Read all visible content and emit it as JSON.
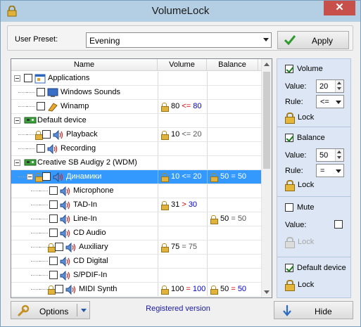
{
  "window": {
    "title": "VolumeLock",
    "close_glyph": "✕"
  },
  "preset": {
    "label": "User Preset:",
    "value": "Evening",
    "apply_label": "Apply"
  },
  "columns": {
    "name": "Name",
    "volume": "Volume",
    "balance": "Balance"
  },
  "rows": [
    {
      "name": "Applications",
      "level": 0,
      "icon": "applications-icon",
      "expand": true,
      "checkbox": true,
      "locked": false
    },
    {
      "name": "Windows Sounds",
      "level": 1,
      "icon": "windows-sounds-icon",
      "checkbox": true,
      "locked": false
    },
    {
      "name": "Winamp",
      "level": 1,
      "icon": "winamp-icon",
      "checkbox": true,
      "locked": false,
      "vol": {
        "locked": true,
        "value": "80",
        "rule": "<=",
        "target": "80",
        "rule_color": "red",
        "target_color": "blue"
      }
    },
    {
      "name": "Default device",
      "level": 0,
      "icon": "sound-card-icon",
      "expand": true,
      "locked": false
    },
    {
      "name": "Playback",
      "level": 1,
      "icon": "speaker-icon",
      "checkbox": true,
      "locked": true,
      "vol": {
        "locked": true,
        "value": "10",
        "rule": "<=",
        "target": "20",
        "rule_color": "gray",
        "target_color": "gray"
      }
    },
    {
      "name": "Recording",
      "level": 1,
      "icon": "speaker-icon",
      "checkbox": true,
      "locked": false
    },
    {
      "name": "Creative SB Audigy 2 (WDM)",
      "level": 0,
      "icon": "sound-card-icon",
      "expand": true,
      "locked": false
    },
    {
      "name": "Динамики",
      "level": 1,
      "icon": "speaker-icon",
      "expand": true,
      "locked": true,
      "selected": true,
      "vol": {
        "locked": true,
        "value": "10",
        "rule": "<=",
        "target": "20",
        "rule_color": "none",
        "target_color": "none"
      },
      "bal": {
        "locked": true,
        "value": "50",
        "rule": "=",
        "target": "50",
        "rule_color": "none",
        "target_color": "none"
      }
    },
    {
      "name": "Microphone",
      "level": 2,
      "icon": "speaker-icon",
      "checkbox": true,
      "locked": false
    },
    {
      "name": "TAD-In",
      "level": 2,
      "icon": "speaker-icon",
      "checkbox": true,
      "locked": false,
      "vol": {
        "locked": true,
        "value": "31",
        "rule": ">",
        "target": "30",
        "rule_color": "red",
        "target_color": "blue"
      }
    },
    {
      "name": "Line-In",
      "level": 2,
      "icon": "speaker-icon",
      "checkbox": true,
      "locked": false,
      "bal": {
        "locked": true,
        "value": "50",
        "rule": "=",
        "target": "50",
        "rule_color": "gray",
        "target_color": "gray"
      }
    },
    {
      "name": "CD Audio",
      "level": 2,
      "icon": "speaker-icon",
      "checkbox": true,
      "locked": false
    },
    {
      "name": "Auxiliary",
      "level": 2,
      "icon": "speaker-icon",
      "checkbox": true,
      "locked": true,
      "vol": {
        "locked": true,
        "value": "75",
        "rule": "=",
        "target": "75",
        "rule_color": "gray",
        "target_color": "gray"
      }
    },
    {
      "name": "CD Digital",
      "level": 2,
      "icon": "speaker-icon",
      "checkbox": true,
      "locked": false
    },
    {
      "name": "S/PDIF-In",
      "level": 2,
      "icon": "speaker-icon",
      "checkbox": true,
      "locked": false
    },
    {
      "name": "MIDI Synth",
      "level": 2,
      "icon": "speaker-icon",
      "checkbox": true,
      "locked": true,
      "vol": {
        "locked": true,
        "value": "100",
        "rule": "=",
        "target": "100",
        "rule_color": "red",
        "target_color": "blue"
      },
      "bal": {
        "locked": true,
        "value": "50",
        "rule": "=",
        "target": "50",
        "rule_color": "red",
        "target_color": "blue"
      }
    }
  ],
  "side": {
    "volume": {
      "label": "Volume",
      "checked": true,
      "value_label": "Value:",
      "value": "20",
      "rule_label": "Rule:",
      "rule": "<=",
      "lock_label": "Lock"
    },
    "balance": {
      "label": "Balance",
      "checked": true,
      "value_label": "Value:",
      "value": "50",
      "rule_label": "Rule:",
      "rule": "=",
      "lock_label": "Lock"
    },
    "mute": {
      "label": "Mute",
      "checked": false,
      "value_label": "Value:",
      "lock_label": "Lock"
    },
    "default_device": {
      "label": "Default device",
      "checked": true,
      "lock_label": "Lock"
    }
  },
  "bottom": {
    "options_label": "Options",
    "registered": "Registered version",
    "hide_label": "Hide"
  },
  "colors": {
    "selection": "#3399ff",
    "side_panel": "#dce6f4",
    "rule_red": "#d40000",
    "rule_blue": "#0000c8",
    "registered": "#1a1aa8"
  }
}
